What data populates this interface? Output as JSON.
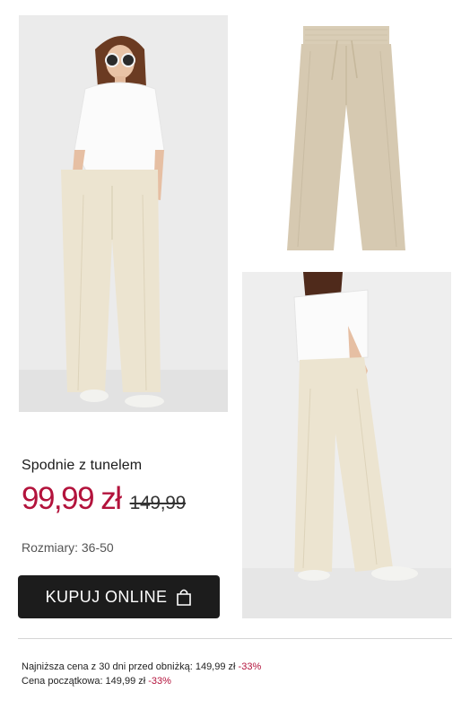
{
  "product": {
    "title": "Spodnie z tunelem",
    "price": "99,99 zł",
    "old_price": "149,99",
    "sizes": "Rozmiary: 36-50"
  },
  "cta": {
    "label": "KUPUJ ONLINE",
    "icon": "shopping-bag-icon"
  },
  "footnotes": {
    "lowest_price_label": "Najniższa cena z 30 dni  przed obniżką: 149,99 zł",
    "lowest_price_discount": "-33%",
    "initial_price_label": "Cena początkowa: 149,99 zł",
    "initial_price_discount": "-33%"
  },
  "colors": {
    "accent": "#b3133c",
    "button": "#1c1c1c",
    "trousers": "#ece4d0"
  }
}
